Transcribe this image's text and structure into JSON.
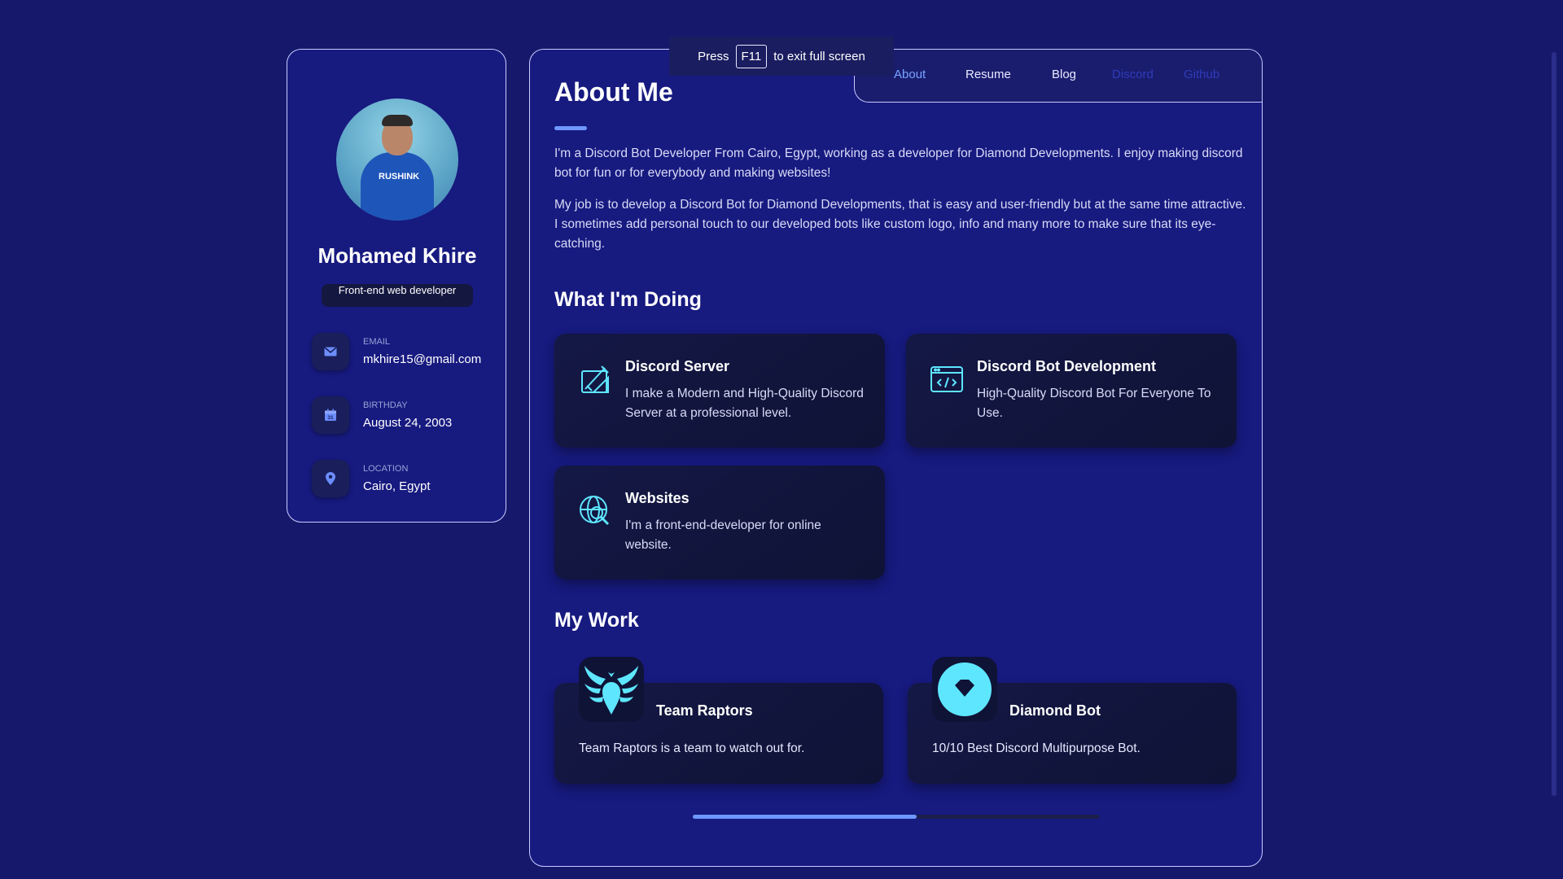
{
  "fullscreen_notice": {
    "prefix": "Press",
    "key": "F11",
    "suffix": "to exit full screen"
  },
  "profile": {
    "name": "Mohamed Khire",
    "role": "Front-end web developer",
    "avatar_text": "RUSHINK",
    "contacts": [
      {
        "label": "Email",
        "value": "mkhire15@gmail.com",
        "icon": "mail-icon"
      },
      {
        "label": "Birthday",
        "value": "August 24, 2003",
        "icon": "calendar-icon"
      },
      {
        "label": "Location",
        "value": "Cairo, Egypt",
        "icon": "location-pin-icon"
      }
    ]
  },
  "nav": {
    "items": [
      {
        "label": "About",
        "state": "active"
      },
      {
        "label": "Resume",
        "state": "normal"
      },
      {
        "label": "Blog",
        "state": "normal"
      },
      {
        "label": "Discord",
        "state": "muted"
      },
      {
        "label": "Github",
        "state": "muted"
      }
    ]
  },
  "about": {
    "title": "About Me",
    "paragraphs": [
      "I'm a Discord Bot Developer From Cairo, Egypt, working as a developer for Diamond Developments. I enjoy making discord bot for fun or for everybody and making websites!",
      "My job is to develop a Discord Bot for Diamond Developments, that is easy and user-friendly but at the same time attractive. I sometimes add personal touch to our developed bots like custom logo, info and many more to make sure that its eye-catching."
    ]
  },
  "services": {
    "title": "What I'm Doing",
    "items": [
      {
        "title": "Discord Server",
        "desc": "I make a Modern and High-Quality Discord Server at a professional level.",
        "icon": "design-tools-icon"
      },
      {
        "title": "Discord Bot Development",
        "desc": "High-Quality Discord Bot For Everyone To Use.",
        "icon": "code-window-icon"
      },
      {
        "title": "Websites",
        "desc": "I'm a front-end-developer for online website.",
        "icon": "globe-search-icon"
      }
    ]
  },
  "work": {
    "title": "My Work",
    "items": [
      {
        "title": "Team Raptors",
        "desc": "Team Raptors is a team to watch out for.",
        "icon": "raptor-logo-icon"
      },
      {
        "title": "Diamond Bot",
        "desc": "10/10 Best Discord Multipurpose Bot.",
        "icon": "diamond-logo-icon"
      }
    ]
  },
  "carousel_progress": 0.55,
  "colors": {
    "accent": "#6e98ff",
    "icon": "#5ee6ff",
    "background": "#16196b",
    "card": "#141845"
  }
}
